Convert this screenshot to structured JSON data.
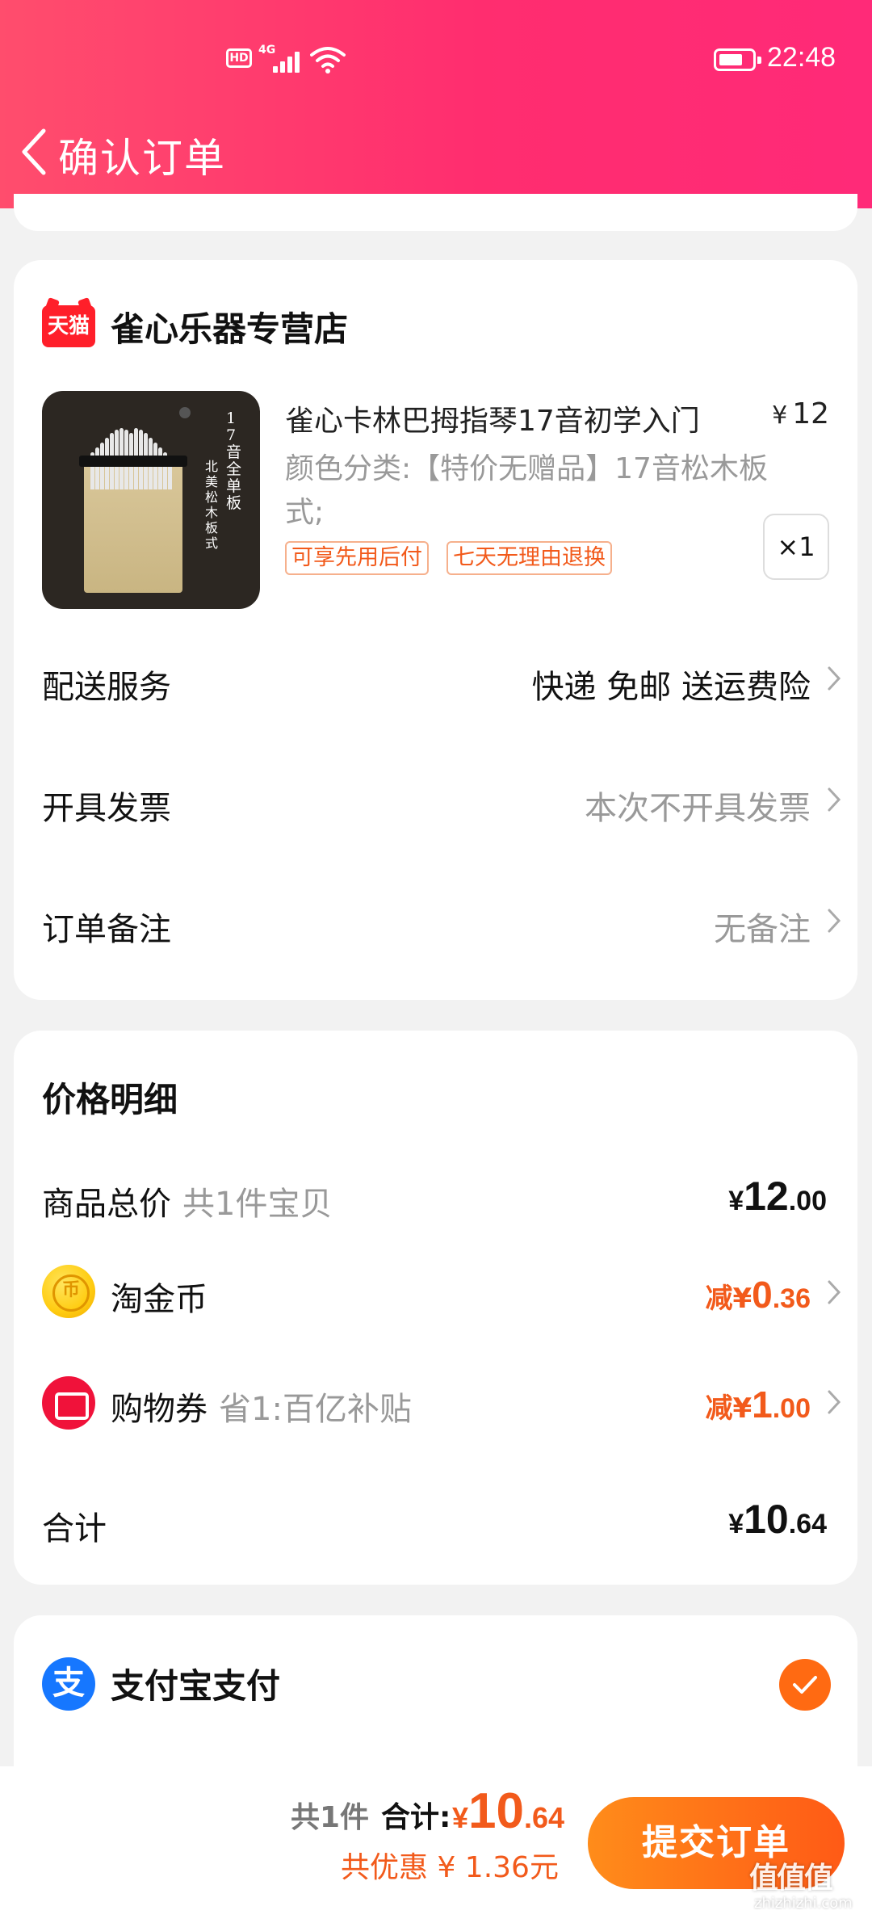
{
  "status_bar": {
    "hd": "HD",
    "network": "4G",
    "time": "22:48"
  },
  "header": {
    "title": "确认订单"
  },
  "store": {
    "logo_text": "天猫",
    "name": "雀心乐器专营店"
  },
  "product": {
    "title": "雀心卡林巴拇指琴17音初学入门",
    "price_symbol": "¥",
    "price": "12",
    "spec": "颜色分类:【特价无赠品】17音松木板式;",
    "image_text_1": "17音全单板",
    "image_text_2": "北美松木板式",
    "tags": [
      "可享先用后付",
      "七天无理由退换"
    ],
    "quantity": "×1"
  },
  "order_rows": [
    {
      "label": "配送服务",
      "value": "快递 免邮 送运费险"
    },
    {
      "label": "开具发票",
      "value": "本次不开具发票"
    },
    {
      "label": "订单备注",
      "value": "无备注"
    }
  ],
  "price_detail": {
    "title": "价格明细",
    "goods_total": {
      "label": "商品总价",
      "sub": "共1件宝贝",
      "symbol": "¥",
      "integer": "12",
      "decimal": ".00"
    },
    "taojinbi": {
      "label": "淘金币",
      "prefix": "减",
      "symbol": "¥",
      "integer": "0",
      "decimal": ".36"
    },
    "coupon": {
      "label": "购物券",
      "sub": "省1:百亿补贴",
      "prefix": "减",
      "symbol": "¥",
      "integer": "1",
      "decimal": ".00"
    },
    "total": {
      "label": "合计",
      "symbol": "¥",
      "integer": "10",
      "decimal": ".64"
    }
  },
  "payment": {
    "icon_text": "支",
    "label": "支付宝支付",
    "selected": true
  },
  "bottom_bar": {
    "count": "共1件",
    "total_label": "合计:",
    "symbol": "¥",
    "integer": "10",
    "decimal": ".64",
    "savings": "共优惠 ¥ 1.36元",
    "submit": "提交订单"
  },
  "watermark": {
    "main": "值值值",
    "sub": "zhizhizhi.com"
  },
  "colors": {
    "header_gradient_start": "#ff4d6d",
    "header_gradient_end": "#ff2a78",
    "accent_orange": "#f25a1b",
    "submit_gradient_start": "#ff8c1a",
    "submit_gradient_end": "#ff5a16",
    "alipay_blue": "#1677ff"
  }
}
